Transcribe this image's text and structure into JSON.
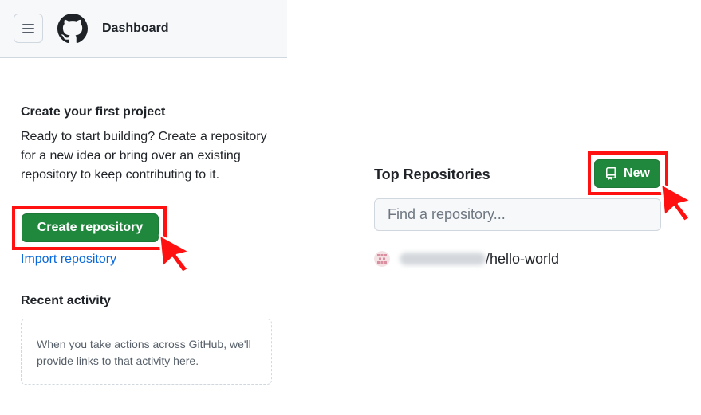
{
  "header": {
    "title": "Dashboard",
    "menu_icon": "hamburger-icon",
    "logo_icon": "github-logo-icon"
  },
  "left": {
    "create_title": "Create your first project",
    "create_desc": "Ready to start building? Create a repository for a new idea or bring over an existing repository to keep contributing to it.",
    "create_button": "Create repository",
    "import_link": "Import repository",
    "recent_title": "Recent activity",
    "recent_text": "When you take actions across GitHub, we'll provide links to that activity here."
  },
  "right": {
    "title": "Top Repositories",
    "new_button": "New",
    "search_placeholder": "Find a repository...",
    "repos": [
      {
        "owner": "",
        "name": "/hello-world"
      }
    ]
  },
  "colors": {
    "primary_button": "#1f883d",
    "link": "#0969da",
    "highlight": "#ff1111"
  }
}
